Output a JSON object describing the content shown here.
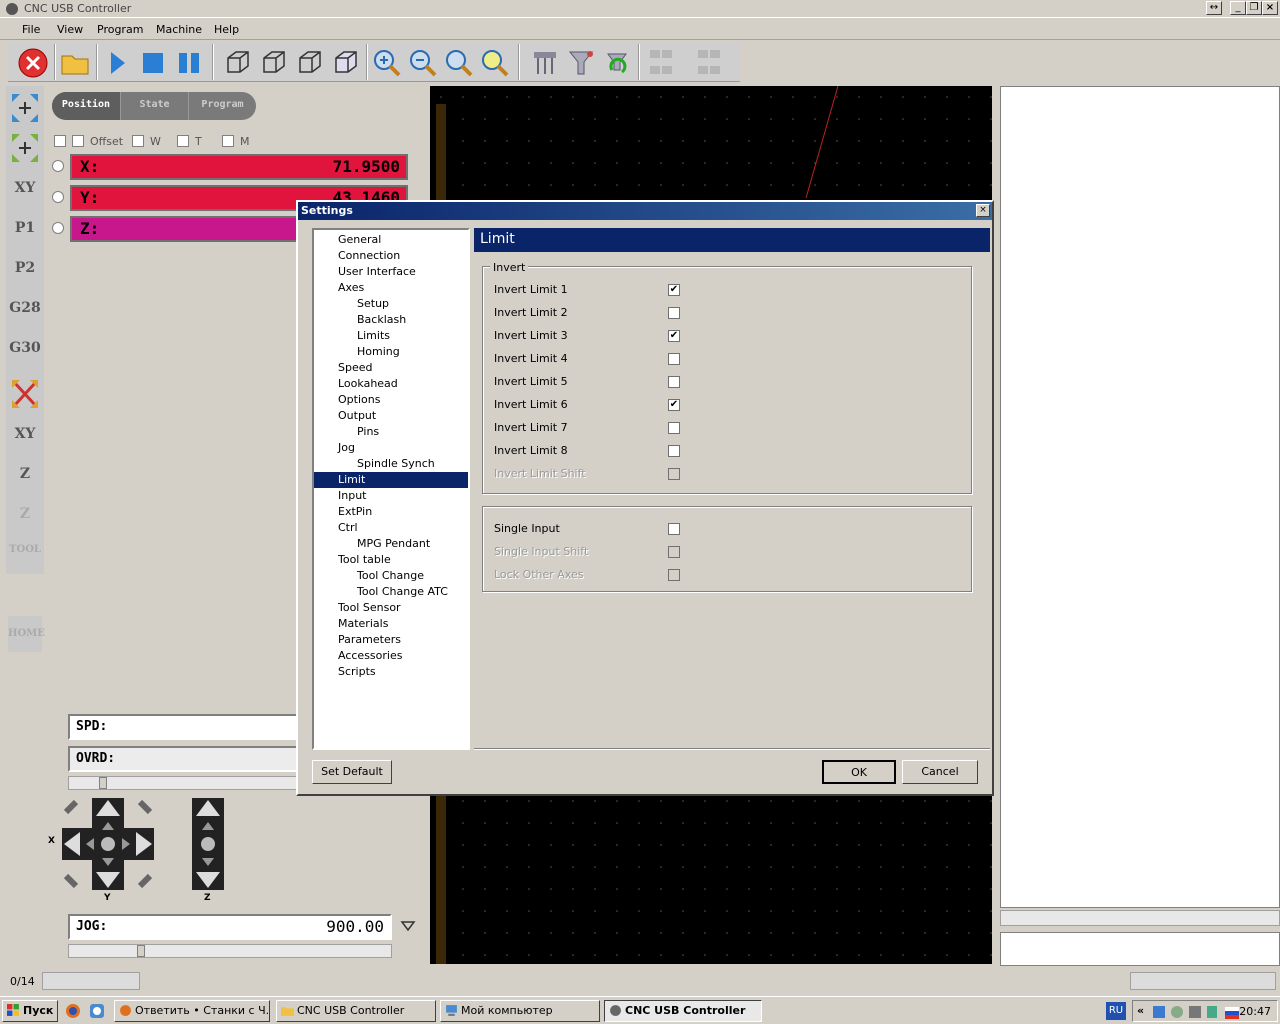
{
  "window": {
    "title": "CNC USB Controller"
  },
  "menu": [
    "File",
    "View",
    "Program",
    "Machine",
    "Help"
  ],
  "toolbar": {
    "icons": [
      "stop-icon",
      "open-folder-icon",
      "play-icon",
      "stop-square-icon",
      "pause-icon",
      "view-iso-icon",
      "view-front-icon",
      "view-side-icon",
      "view-top-icon",
      "zoom-in-icon",
      "zoom-out-icon",
      "zoom-fit-icon",
      "zoom-window-icon",
      "settings-icon",
      "tool-icon",
      "refresh-icon",
      "align-icon",
      "distribute-icon"
    ]
  },
  "left_strip": [
    "",
    "",
    "XY",
    "P1",
    "P2",
    "G28",
    "G30",
    "",
    "XY",
    "Z",
    "Z",
    "TOOL",
    "HOME"
  ],
  "tabs": [
    "Position",
    "State",
    "Program"
  ],
  "filters": [
    "Offset",
    "W",
    "T",
    "M"
  ],
  "axes": [
    {
      "label": "X:",
      "value": "71.9500",
      "color": "#e0143c"
    },
    {
      "label": "Y:",
      "value": "43.1460",
      "color": "#e0143c"
    },
    {
      "label": "Z:",
      "value": "",
      "color": "#c8168c"
    }
  ],
  "spd": {
    "label": "SPD:"
  },
  "ovrd": {
    "label": "OVRD:"
  },
  "jog": {
    "label": "JOG:",
    "value": "900.00",
    "x": "X",
    "y": "Y",
    "z": "Z"
  },
  "status": {
    "progress": "0/14"
  },
  "settings": {
    "title": "Settings",
    "header": "Limit",
    "tree": [
      {
        "label": "General",
        "level": 0
      },
      {
        "label": "Connection",
        "level": 0
      },
      {
        "label": "User Interface",
        "level": 0
      },
      {
        "label": "Axes",
        "level": 0
      },
      {
        "label": "Setup",
        "level": 1
      },
      {
        "label": "Backlash",
        "level": 1
      },
      {
        "label": "Limits",
        "level": 1
      },
      {
        "label": "Homing",
        "level": 1
      },
      {
        "label": "Speed",
        "level": 0
      },
      {
        "label": "Lookahead",
        "level": 0
      },
      {
        "label": "Options",
        "level": 0
      },
      {
        "label": "Output",
        "level": 0
      },
      {
        "label": "Pins",
        "level": 1
      },
      {
        "label": "Jog",
        "level": 0
      },
      {
        "label": "Spindle Synch",
        "level": 1
      },
      {
        "label": "Limit",
        "level": 0,
        "selected": true
      },
      {
        "label": "Input",
        "level": 0
      },
      {
        "label": "ExtPin",
        "level": 0
      },
      {
        "label": "Ctrl",
        "level": 0
      },
      {
        "label": "MPG Pendant",
        "level": 1
      },
      {
        "label": "Tool table",
        "level": 0
      },
      {
        "label": "Tool Change",
        "level": 1
      },
      {
        "label": "Tool Change ATC",
        "level": 1
      },
      {
        "label": "Tool Sensor",
        "level": 0
      },
      {
        "label": "Materials",
        "level": 0
      },
      {
        "label": "Parameters",
        "level": 0
      },
      {
        "label": "Accessories",
        "level": 0
      },
      {
        "label": "Scripts",
        "level": 0
      }
    ],
    "invert_group": "Invert",
    "invert": [
      {
        "label": "Invert Limit 1",
        "checked": true,
        "enabled": true
      },
      {
        "label": "Invert Limit 2",
        "checked": false,
        "enabled": true
      },
      {
        "label": "Invert Limit 3",
        "checked": true,
        "enabled": true
      },
      {
        "label": "Invert Limit 4",
        "checked": false,
        "enabled": true
      },
      {
        "label": "Invert Limit 5",
        "checked": false,
        "enabled": true
      },
      {
        "label": "Invert Limit 6",
        "checked": true,
        "enabled": true
      },
      {
        "label": "Invert Limit 7",
        "checked": false,
        "enabled": true
      },
      {
        "label": "Invert Limit 8",
        "checked": false,
        "enabled": true
      },
      {
        "label": "Invert Limit Shift",
        "checked": false,
        "enabled": false
      }
    ],
    "single": [
      {
        "label": "Single Input",
        "checked": false,
        "enabled": true
      },
      {
        "label": "Single Input Shift",
        "checked": false,
        "enabled": false
      },
      {
        "label": "Lock Other Axes",
        "checked": false,
        "enabled": false
      }
    ],
    "buttons": {
      "set_default": "Set Default",
      "ok": "OK",
      "cancel": "Cancel"
    }
  },
  "taskbar": {
    "start": "Пуск",
    "tasks": [
      {
        "label": "Ответить • Станки с Ч...",
        "active": false
      },
      {
        "label": "CNC USB Controller",
        "active": false
      },
      {
        "label": "Мой компьютер",
        "active": false
      },
      {
        "label": "CNC USB Controller",
        "active": true
      }
    ],
    "lang": "RU",
    "clock": "20:47"
  }
}
